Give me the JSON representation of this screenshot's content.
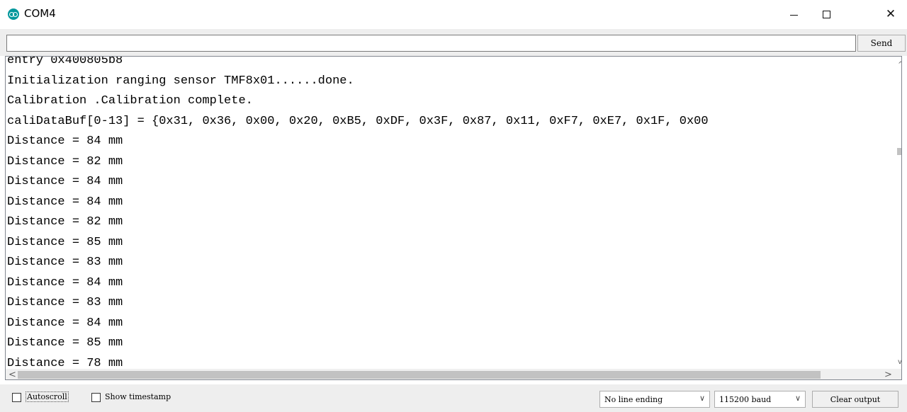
{
  "window": {
    "title": "COM4",
    "icon": "arduino-icon",
    "minimize_icon": "minimize-icon",
    "maximize_icon": "maximize-icon",
    "close_glyph": "✕"
  },
  "send_bar": {
    "input_value": "",
    "send_label": "Send"
  },
  "output": {
    "lines": [
      "entry 0x400805b8",
      "Initialization ranging sensor TMF8x01......done.",
      "Calibration .Calibration complete.",
      "caliDataBuf[0-13] = {0x31, 0x36, 0x00, 0x20, 0xB5, 0xDF, 0x3F, 0x87, 0x11, 0xF7, 0xE7, 0x1F, 0x00",
      "Distance = 84 mm",
      "Distance = 82 mm",
      "Distance = 84 mm",
      "Distance = 84 mm",
      "Distance = 82 mm",
      "Distance = 85 mm",
      "Distance = 83 mm",
      "Distance = 84 mm",
      "Distance = 83 mm",
      "Distance = 84 mm",
      "Distance = 85 mm",
      "Distance = 78 mm"
    ]
  },
  "scrollbars": {
    "up": "^",
    "down": "v",
    "left": "<",
    "right": ">"
  },
  "bottom_bar": {
    "autoscroll_label": "Autoscroll",
    "autoscroll_checked": false,
    "timestamp_label": "Show timestamp",
    "timestamp_checked": false,
    "line_ending": "No line ending",
    "baud_rate": "115200 baud",
    "chevron": "∨",
    "clear_label": "Clear output"
  }
}
